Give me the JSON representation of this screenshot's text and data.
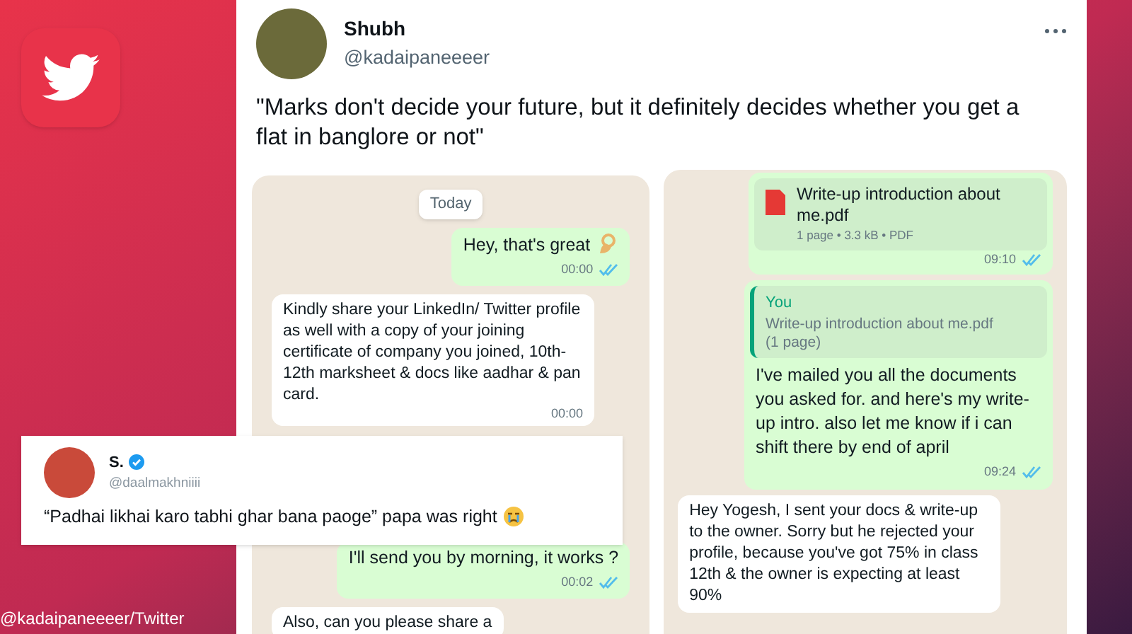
{
  "tweet": {
    "name": "Shubh",
    "handle": "@kadaipaneeeer",
    "text": "\"Marks don't decide your future, but it definitely decides whether you get a flat in banglore or not\""
  },
  "chat_left": [
    {
      "kind": "date",
      "text": "Today"
    },
    {
      "kind": "outgoing",
      "text": "Hey, that's great",
      "time": "00:00",
      "read": true,
      "emoji": true
    },
    {
      "kind": "incoming",
      "text": "Kindly share your LinkedIn/ Twitter profile as well with a copy of your joining certificate of company you joined, 10th-12th marksheet & docs like aadhar & pan card.",
      "time": "00:00"
    },
    {
      "kind": "outgoing",
      "text": "I'll send you by morning, it works ?",
      "time": "00:02",
      "read": true,
      "emoji": false
    },
    {
      "kind": "incoming",
      "text": "Also, can you please share a"
    }
  ],
  "chat_right": [
    {
      "kind": "document",
      "file": "Write-up introduction about me.pdf",
      "meta": "1 page • 3.3 kB • PDF",
      "time": "09:10",
      "read": true
    },
    {
      "kind": "reply",
      "quote_author": "You",
      "quote_text": "Write-up introduction about me.pdf (1 page)",
      "text": "I've mailed you all the documents you asked for. and here's my write-up intro. also let me know if i can shift there by end of april",
      "time": "09:24",
      "read": true
    },
    {
      "kind": "incoming",
      "text": "Hey Yogesh, I sent your docs & write-up to the owner. Sorry but he rejected your profile, because you've got 75% in class 12th & the owner is expecting at least 90%"
    }
  ],
  "reply_tweet": {
    "name": "S.",
    "verified": true,
    "handle": "@daalmakhniiii",
    "text": "“Padhai likhai karo tabhi ghar bana paoge” papa was right"
  },
  "credit": "@kadaipaneeeer/Twitter"
}
